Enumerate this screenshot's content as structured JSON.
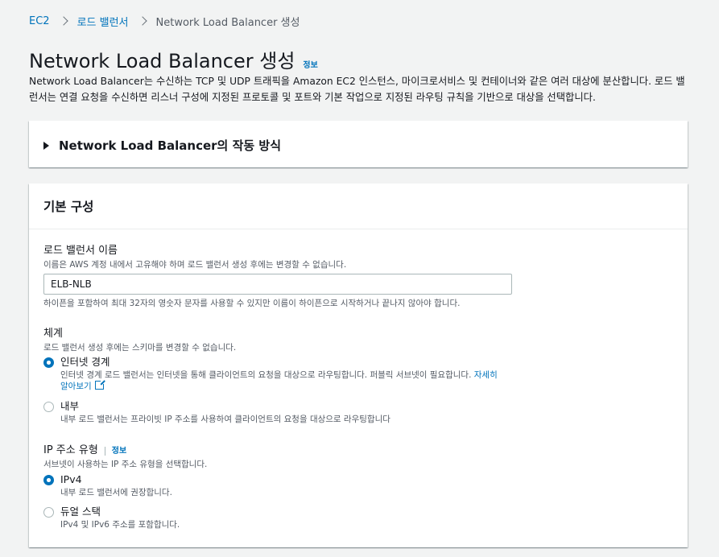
{
  "breadcrumb": {
    "items": [
      "EC2",
      "로드 밸런서"
    ],
    "current": "Network Load Balancer 생성"
  },
  "page": {
    "title": "Network Load Balancer 생성",
    "info": "정보",
    "description": "Network Load Balancer는 수신하는 TCP 및 UDP 트래픽을 Amazon EC2 인스턴스, 마이크로서비스 및 컨테이너와 같은 여러 대상에 분산합니다. 로드 밸런서는 연결 요청을 수신하면 리스너 구성에 지정된 프로토콜 및 포트와 기본 작업으로 지정된 라우팅 규칙을 기반으로 대상을 선택합니다."
  },
  "how_it_works": {
    "title": "Network Load Balancer의 작동 방식"
  },
  "basic_config": {
    "title": "기본 구성",
    "name_field": {
      "label": "로드 밸런서 이름",
      "hint": "이름은 AWS 계정 내에서 고유해야 하며 로드 밸런서 생성 후에는 변경할 수 없습니다.",
      "value": "ELB-NLB",
      "constraint": "하이픈을 포함하여 최대 32자의 영숫자 문자를 사용할 수 있지만 이름이 하이픈으로 시작하거나 끝나지 않아야 합니다."
    },
    "scheme": {
      "label": "체계",
      "hint": "로드 밸런서 생성 후에는 스키마를 변경할 수 없습니다.",
      "options": [
        {
          "label": "인터넷 경계",
          "desc": "인터넷 경계 로드 밸런서는 인터넷을 통해 클라이언트의 요청을 대상으로 라우팅합니다. 퍼블릭 서브넷이 필요합니다.",
          "link": "자세히 알아보기",
          "selected": true
        },
        {
          "label": "내부",
          "desc": "내부 로드 밸런서는 프라이빗 IP 주소를 사용하여 클라이언트의 요청을 대상으로 라우팅합니다",
          "selected": false
        }
      ]
    },
    "ip_type": {
      "label": "IP 주소 유형",
      "info": "정보",
      "hint": "서브넷이 사용하는 IP 주소 유형을 선택합니다.",
      "options": [
        {
          "label": "IPv4",
          "desc": "내부 로드 밸런서에 권장합니다.",
          "selected": true
        },
        {
          "label": "듀얼 스택",
          "desc": "IPv4 및 IPv6 주소를 포함합니다.",
          "selected": false
        }
      ]
    }
  },
  "colors": {
    "link": "#0073bb",
    "background": "#f2f3f3",
    "text": "#16191f",
    "muted": "#545b64"
  }
}
